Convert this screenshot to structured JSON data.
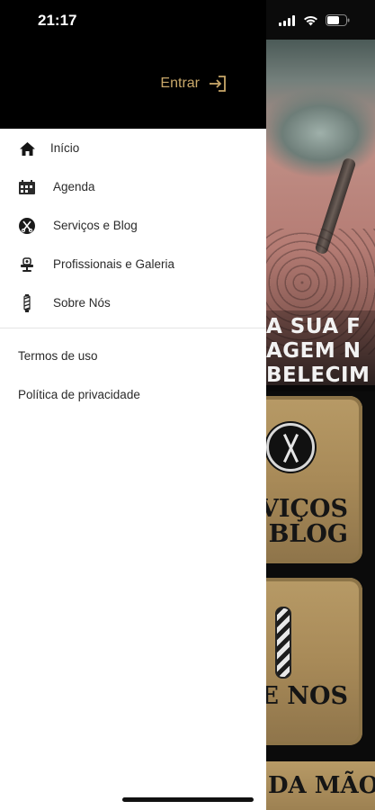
{
  "status_bar": {
    "time": "21:17"
  },
  "drawer": {
    "login_label": "Entrar",
    "menu_items": [
      {
        "label": "Início",
        "icon": "home-icon"
      },
      {
        "label": "Agenda",
        "icon": "calendar-icon"
      },
      {
        "label": "Serviços e Blog",
        "icon": "scissors-emblem-icon"
      },
      {
        "label": "Profissionais e Galeria",
        "icon": "barber-chair-icon"
      },
      {
        "label": "Sobre Nós",
        "icon": "barber-pole-icon"
      }
    ],
    "legal": {
      "terms": "Termos de uso",
      "privacy": "Política de privacidade"
    }
  },
  "background": {
    "banner_lines": [
      "A SUA F",
      "AGEM N",
      "BELECIM"
    ],
    "card_services": "VIÇOS\nBLOG",
    "card_about": "RE NÓS",
    "bottom_banner": "DA MÃO"
  },
  "colors": {
    "accent": "#c9a86a",
    "drawer_bg": "#ffffff",
    "header_bg": "#000000",
    "card_gold": "#b79a66"
  }
}
